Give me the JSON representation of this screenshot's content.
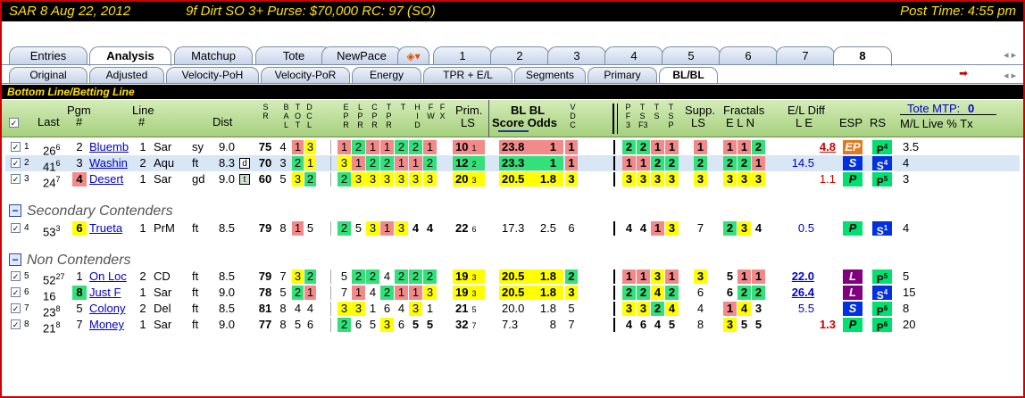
{
  "title": {
    "race": "SAR  8  Aug 22, 2012",
    "info": "9f  Dirt   SO  3+   Purse: $70,000   RC: 97  (SO)",
    "post": "Post Time: 4:55 pm"
  },
  "tabs1": [
    "Entries",
    "Analysis",
    "Matchup",
    "Tote",
    "NewPace",
    "",
    "1",
    "2",
    "3",
    "4",
    "5",
    "6",
    "7",
    "8"
  ],
  "tabs2": [
    "Original",
    "Adjusted",
    "Velocity-PoH",
    "Velocity-PoR",
    "Energy",
    "TPR + E/L",
    "Segments",
    "Primary",
    "BL/BL"
  ],
  "bl_title": "Bottom Line/Betting Line",
  "headers": {
    "last": "Last",
    "pgm": "Pgm",
    "pgm2": "#",
    "line": "Line",
    "line2": "#",
    "dist": "Dist",
    "prim": "Prim.",
    "ls": "LS",
    "bl1": "BL  BL",
    "bl2": "Score Odds",
    "supp": "Supp.",
    "supp_ls": "LS",
    "fractals": "Fractals",
    "eln": "E  L  N",
    "eldiff": "E/L Diff",
    "le": "L     E",
    "esp": "ESP",
    "rs": "RS",
    "tote": "Tote MTP:",
    "mtp": "0",
    "ml": "M/L  Live  %     Tx"
  },
  "sections": {
    "secondary": "Secondary Contenders",
    "non": "Non Contenders"
  },
  "rows": [
    {
      "n": "1",
      "last": "26",
      "lsup": "6",
      "pgm": "2",
      "name": "Bluemb",
      "line": "1",
      "trk": "Sar",
      "cond": "sy",
      "dist": "9.0",
      "sr": "75",
      "b": "4",
      "t": [
        "1",
        "3"
      ],
      "el": [
        "1",
        "2",
        "1",
        "1",
        "2",
        "2",
        "1"
      ],
      "prim": "10",
      "pls": "1",
      "bls": "23.8",
      "blo": "1",
      "vdc": "1",
      "pf": [
        "2",
        "2",
        "1",
        "1"
      ],
      "sls": "1",
      "fr": [
        "1",
        "1",
        "2"
      ],
      "L": "",
      "E": "4.8",
      "esp": "EP",
      "rs": "P",
      "rss": "4",
      "ml": "3.5"
    },
    {
      "n": "2",
      "last": "41",
      "lsup": "6",
      "pgm": "3",
      "name": "Washin",
      "line": "2",
      "trk": "Aqu",
      "cond": "ft",
      "dist": "8.3",
      "flag": "d",
      "sr": "70",
      "b": "3",
      "t": [
        "2",
        "1"
      ],
      "el": [
        "3",
        "1",
        "2",
        "2",
        "1",
        "1",
        "2"
      ],
      "prim": "12",
      "pls": "2",
      "bls": "23.3",
      "blo": "1",
      "vdc": "1",
      "pf": [
        "1",
        "1",
        "2",
        "2"
      ],
      "sls": "2",
      "fr": [
        "2",
        "2",
        "1"
      ],
      "L": "14.5",
      "E": "",
      "esp": "S",
      "rs": "S",
      "rss": "4",
      "ml": "4"
    },
    {
      "n": "3",
      "last": "24",
      "lsup": "7",
      "pgm": "4",
      "name": "Desert",
      "line": "1",
      "trk": "Sar",
      "cond": "gd",
      "dist": "9.0",
      "flag": "t",
      "sr": "60",
      "b": "5",
      "t": [
        "3",
        "2"
      ],
      "el": [
        "2",
        "3",
        "3",
        "3",
        "3",
        "3",
        "3"
      ],
      "prim": "20",
      "pls": "3",
      "bls": "20.5",
      "blo": "1.8",
      "vdc": "3",
      "pf": [
        "3",
        "3",
        "3",
        "3"
      ],
      "sls": "3",
      "fr": [
        "3",
        "3",
        "3"
      ],
      "L": "",
      "E": "1.1",
      "esp": "P",
      "rs": "P",
      "rss": "5",
      "ml": "3"
    },
    {
      "n": "4",
      "last": "53",
      "lsup": "3",
      "pgm": "6",
      "name": "Trueta",
      "line": "1",
      "trk": "PrM",
      "cond": "ft",
      "dist": "8.5",
      "sr": "79",
      "b": "8",
      "t": [
        "1",
        "5"
      ],
      "el": [
        "2",
        "5",
        "3",
        "1",
        "3",
        "4",
        "4"
      ],
      "prim": "22",
      "pls": "6",
      "bls": "17.3",
      "blo": "2.5",
      "vdc": "6",
      "pf": [
        "4",
        "4",
        "1",
        "3"
      ],
      "sls": "7",
      "fr": [
        "2",
        "3",
        "4"
      ],
      "L": "0.5",
      "E": "",
      "esp": "P",
      "rs": "S",
      "rss": "1",
      "ml": "4"
    },
    {
      "n": "5",
      "last": "52",
      "lsup": "27",
      "pgm": "1",
      "name": "On Loc",
      "line": "2",
      "trk": "CD",
      "cond": "ft",
      "dist": "8.5",
      "sr": "79",
      "b": "7",
      "t": [
        "3",
        "2"
      ],
      "el": [
        "5",
        "2",
        "2",
        "4",
        "2",
        "2",
        "2"
      ],
      "prim": "19",
      "pls": "3",
      "bls": "20.5",
      "blo": "1.8",
      "vdc": "2",
      "pf": [
        "1",
        "1",
        "3",
        "1"
      ],
      "sls": "3",
      "fr": [
        "5",
        "1",
        "1"
      ],
      "L": "22.0",
      "E": "",
      "esp": "L",
      "rs": "P",
      "rss": "5",
      "ml": "5"
    },
    {
      "n": "6",
      "last": "16",
      "lsup": "",
      "pgm": "8",
      "name": "Just F",
      "line": "1",
      "trk": "Sar",
      "cond": "ft",
      "dist": "9.0",
      "sr": "78",
      "b": "5",
      "t": [
        "2",
        "1"
      ],
      "el": [
        "7",
        "1",
        "4",
        "2",
        "1",
        "1",
        "3"
      ],
      "prim": "19",
      "pls": "3",
      "bls": "20.5",
      "blo": "1.8",
      "vdc": "3",
      "pf": [
        "2",
        "2",
        "4",
        "2"
      ],
      "sls": "6",
      "fr": [
        "6",
        "2",
        "2"
      ],
      "L": "26.4",
      "E": "",
      "esp": "L",
      "rs": "S",
      "rss": "4",
      "ml": "15"
    },
    {
      "n": "7",
      "last": "23",
      "lsup": "8",
      "pgm": "5",
      "name": "Colony",
      "line": "2",
      "trk": "Del",
      "cond": "ft",
      "dist": "8.5",
      "sr": "81",
      "b": "8",
      "t": [
        "4",
        "4"
      ],
      "el": [
        "3",
        "3",
        "1",
        "6",
        "4",
        "3",
        "1"
      ],
      "prim": "21",
      "pls": "5",
      "bls": "20.0",
      "blo": "1.8",
      "vdc": "5",
      "pf": [
        "3",
        "3",
        "2",
        "4"
      ],
      "sls": "4",
      "fr": [
        "1",
        "4",
        "3"
      ],
      "L": "5.5",
      "E": "",
      "esp": "S",
      "rs": "P",
      "rss": "6",
      "ml": "8"
    },
    {
      "n": "8",
      "last": "21",
      "lsup": "8",
      "pgm": "7",
      "name": "Money",
      "line": "1",
      "trk": "Sar",
      "cond": "ft",
      "dist": "9.0",
      "sr": "77",
      "b": "8",
      "t": [
        "5",
        "6"
      ],
      "el": [
        "2",
        "6",
        "5",
        "3",
        "6",
        "5",
        "5"
      ],
      "prim": "32",
      "pls": "7",
      "bls": "7.3",
      "blo": "8",
      "vdc": "7",
      "pf": [
        "4",
        "6",
        "4",
        "5"
      ],
      "sls": "8",
      "fr": [
        "3",
        "5",
        "5"
      ],
      "L": "",
      "E": "1.3",
      "esp": "P",
      "rs": "P",
      "rss": "6",
      "ml": "20"
    }
  ]
}
